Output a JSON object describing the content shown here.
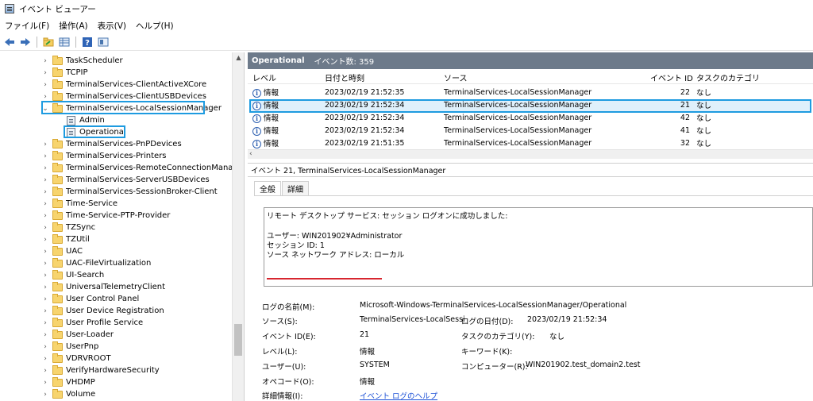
{
  "window": {
    "title": "イベント ビューアー"
  },
  "menu": [
    "ファイル(F)",
    "操作(A)",
    "表示(V)",
    "ヘルプ(H)"
  ],
  "toolbar": {
    "icons": [
      "back-arrow-icon",
      "forward-arrow-icon",
      "open-folder-icon",
      "grid-icon",
      "help-icon",
      "panel-icon"
    ]
  },
  "tree": {
    "items": [
      {
        "label": "TaskScheduler",
        "type": "folder"
      },
      {
        "label": "TCPIP",
        "type": "folder"
      },
      {
        "label": "TerminalServices-ClientActiveXCore",
        "type": "folder"
      },
      {
        "label": "TerminalServices-ClientUSBDevices",
        "type": "folder"
      },
      {
        "label": "TerminalServices-LocalSessionManager",
        "type": "folder",
        "expanded": true
      },
      {
        "label": "Admin",
        "type": "log"
      },
      {
        "label": "Operational",
        "type": "log"
      },
      {
        "label": "TerminalServices-PnPDevices",
        "type": "folder"
      },
      {
        "label": "TerminalServices-Printers",
        "type": "folder"
      },
      {
        "label": "TerminalServices-RemoteConnectionManager",
        "type": "folder"
      },
      {
        "label": "TerminalServices-ServerUSBDevices",
        "type": "folder"
      },
      {
        "label": "TerminalServices-SessionBroker-Client",
        "type": "folder"
      },
      {
        "label": "Time-Service",
        "type": "folder"
      },
      {
        "label": "Time-Service-PTP-Provider",
        "type": "folder"
      },
      {
        "label": "TZSync",
        "type": "folder"
      },
      {
        "label": "TZUtil",
        "type": "folder"
      },
      {
        "label": "UAC",
        "type": "folder"
      },
      {
        "label": "UAC-FileVirtualization",
        "type": "folder"
      },
      {
        "label": "UI-Search",
        "type": "folder"
      },
      {
        "label": "UniversalTelemetryClient",
        "type": "folder"
      },
      {
        "label": "User Control Panel",
        "type": "folder"
      },
      {
        "label": "User Device Registration",
        "type": "folder"
      },
      {
        "label": "User Profile Service",
        "type": "folder"
      },
      {
        "label": "User-Loader",
        "type": "folder"
      },
      {
        "label": "UserPnp",
        "type": "folder"
      },
      {
        "label": "VDRVROOT",
        "type": "folder"
      },
      {
        "label": "VerifyHardwareSecurity",
        "type": "folder"
      },
      {
        "label": "VHDMP",
        "type": "folder"
      },
      {
        "label": "Volume",
        "type": "folder"
      }
    ]
  },
  "panel": {
    "name": "Operational",
    "count": "イベント数: 359"
  },
  "grid": {
    "headers": {
      "level": "レベル",
      "datetime": "日付と時刻",
      "source": "ソース",
      "event_id": "イベント ID",
      "category": "タスクのカテゴリ"
    },
    "rows": [
      {
        "level": "情報",
        "datetime": "2023/02/19 21:52:35",
        "source": "TerminalServices-LocalSessionManager",
        "event_id": "22",
        "category": "なし"
      },
      {
        "level": "情報",
        "datetime": "2023/02/19 21:52:34",
        "source": "TerminalServices-LocalSessionManager",
        "event_id": "21",
        "category": "なし"
      },
      {
        "level": "情報",
        "datetime": "2023/02/19 21:52:34",
        "source": "TerminalServices-LocalSessionManager",
        "event_id": "42",
        "category": "なし"
      },
      {
        "level": "情報",
        "datetime": "2023/02/19 21:52:34",
        "source": "TerminalServices-LocalSessionManager",
        "event_id": "41",
        "category": "なし"
      },
      {
        "level": "情報",
        "datetime": "2023/02/19 21:51:35",
        "source": "TerminalServices-LocalSessionManager",
        "event_id": "32",
        "category": "なし"
      }
    ]
  },
  "detail": {
    "title": "イベント 21, TerminalServices-LocalSessionManager",
    "tabs": [
      "全般",
      "詳細"
    ],
    "description": [
      "リモート デスクトップ サービス: セッション ログオンに成功しました:",
      "",
      "ユーザー: WIN201902¥Administrator",
      "セッション ID: 1",
      "ソース ネットワーク アドレス: ローカル"
    ],
    "props": {
      "log_name_label": "ログの名前(M):",
      "log_name_value": "Microsoft-Windows-TerminalServices-LocalSessionManager/Operational",
      "source_label": "ソース(S):",
      "source_value": "TerminalServices-LocalSessi",
      "logged_label": "ログの日付(D):",
      "logged_value": "2023/02/19 21:52:34",
      "event_id_label": "イベント ID(E):",
      "event_id_value": "21",
      "task_label": "タスクのカテゴリ(Y):",
      "task_value": "なし",
      "level_label": "レベル(L):",
      "level_value": "情報",
      "keywords_label": "キーワード(K):",
      "keywords_value": "",
      "user_label": "ユーザー(U):",
      "user_value": "SYSTEM",
      "computer_label": "コンピューター(R):",
      "computer_value": "WIN201902.test_domain2.test",
      "opcode_label": "オペコード(O):",
      "opcode_value": "情報",
      "more_info_label": "詳細情報(I):",
      "more_info_link": "イベント ログのヘルプ"
    }
  },
  "colors": {
    "highlight_border": "#1e9be0",
    "panel_header": "#6d7a8a",
    "underline": "#d7262f",
    "link": "#1a4fd6"
  }
}
